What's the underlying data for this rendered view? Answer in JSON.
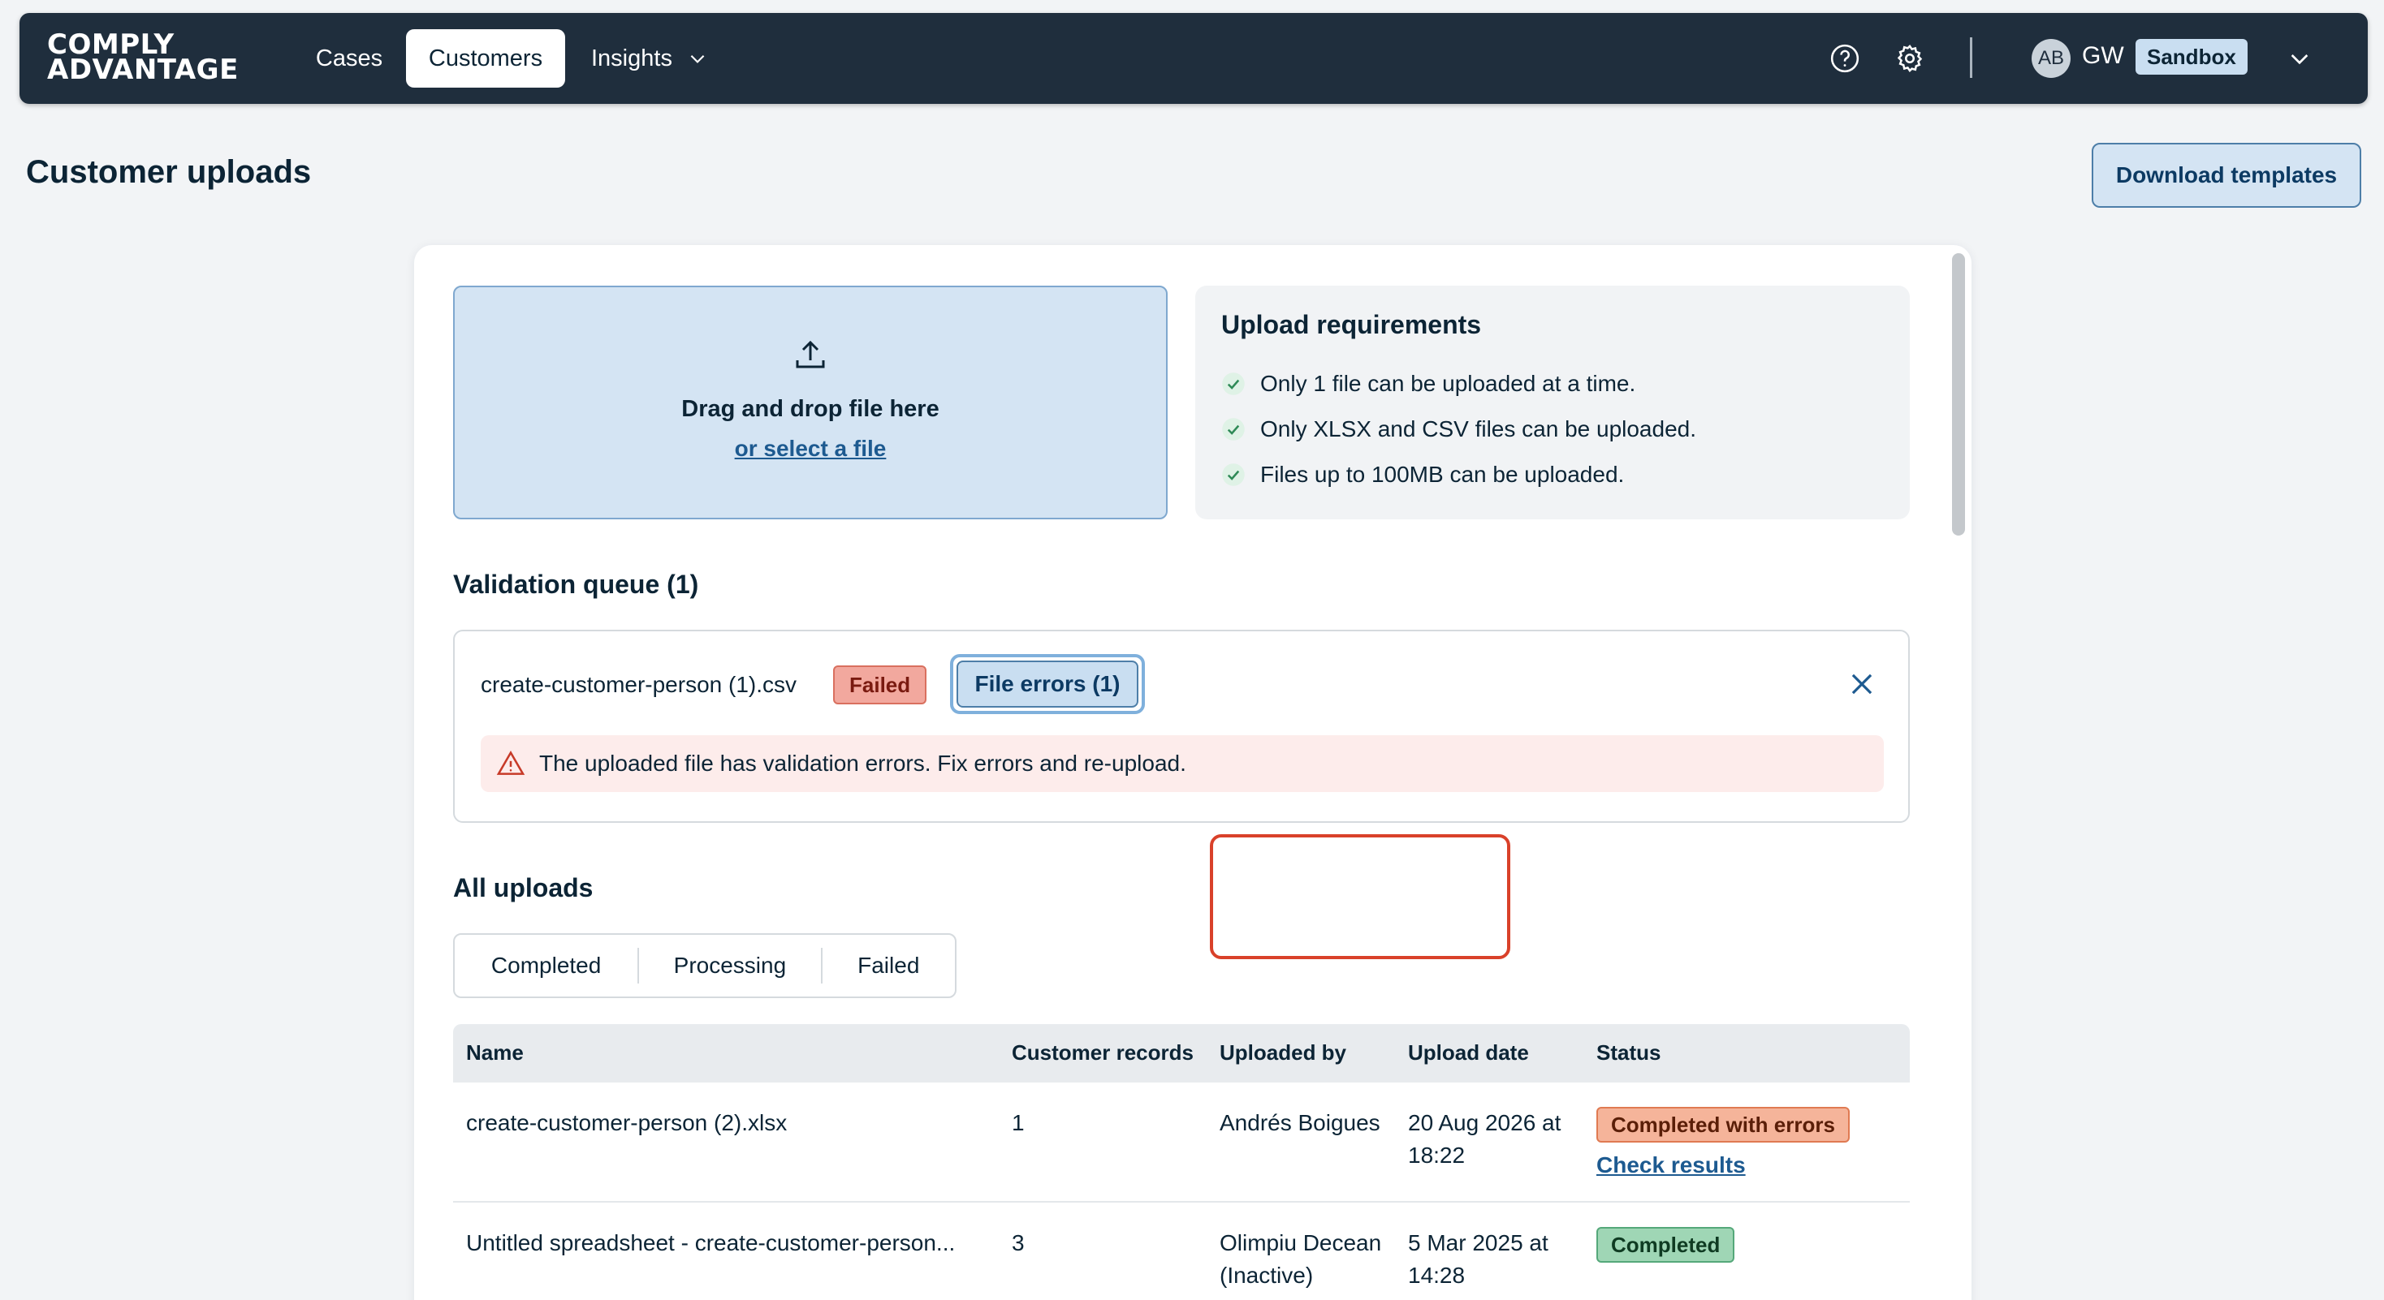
{
  "nav": {
    "logo_line1": "COMPLY",
    "logo_line2": "ADVANTAGE",
    "items": [
      {
        "label": "Cases"
      },
      {
        "label": "Customers"
      },
      {
        "label": "Insights"
      }
    ],
    "user_avatar": "AB",
    "user_initials": "GW",
    "environment": "Sandbox",
    "icons": {
      "help": "question-circle-icon",
      "settings": "gear-icon",
      "menu": "chevron-down-icon"
    }
  },
  "page": {
    "title": "Customer uploads",
    "download_templates": "Download templates"
  },
  "dropzone": {
    "title": "Drag and drop file here",
    "link": "or select a file"
  },
  "requirements": {
    "title": "Upload requirements",
    "items": [
      "Only 1 file can be uploaded at a time.",
      "Only XLSX and CSV files can be uploaded.",
      "Files up to 100MB can be uploaded."
    ]
  },
  "queue": {
    "title": "Validation queue (1)",
    "file_name": "create-customer-person (1).csv",
    "status": "Failed",
    "errors_button": "File errors (1)",
    "error_message": "The uploaded file has validation errors. Fix errors and re-upload."
  },
  "uploads": {
    "title": "All uploads",
    "tabs": [
      "Completed",
      "Processing",
      "Failed"
    ],
    "columns": [
      "Name",
      "Customer records",
      "Uploaded by",
      "Upload date",
      "Status"
    ],
    "rows": [
      {
        "name": "create-customer-person (2).xlsx",
        "records": "1",
        "uploaded_by": "Andrés Boigues",
        "date": "20 Aug 2026 at 18:22",
        "status": "Completed with errors",
        "link": "Check results"
      },
      {
        "name": "Untitled spreadsheet - create-customer-person...",
        "records": "3",
        "uploaded_by": "Olimpiu Decean (Inactive)",
        "date": "5 Mar 2025 at 14:28",
        "status": "Completed"
      }
    ]
  },
  "colors": {
    "navbar": "#1f2e3d",
    "accent": "#1d5a90",
    "failed": "#f2a89e",
    "warning": "#f5b49a",
    "success": "#9fd6b5",
    "highlight": "#d9412a"
  }
}
